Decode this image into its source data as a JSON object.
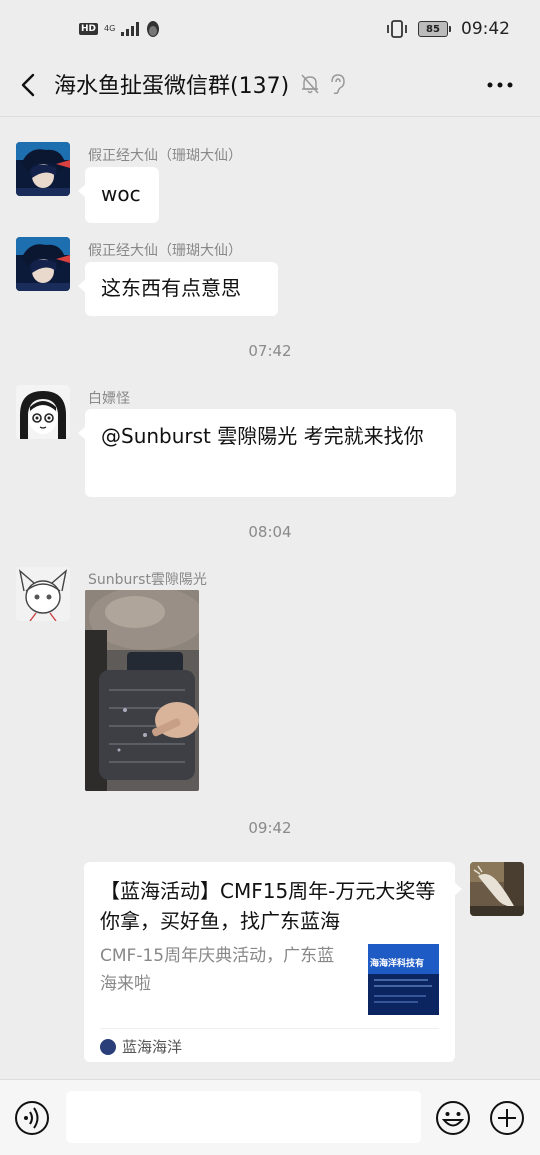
{
  "status_bar": {
    "network_badge": "HD",
    "signal_label": "4G",
    "battery_level": "85",
    "time": "09:42"
  },
  "nav": {
    "title": "海水鱼扯蛋微信群(137)"
  },
  "messages": [
    {
      "sender": "假正经大仙（珊瑚大仙）",
      "text": "woc"
    },
    {
      "sender": "假正经大仙（珊瑚大仙）",
      "text": "这东西有点意思"
    },
    {
      "sender": "白嫖怪",
      "text": "@Sunburst 雲隙陽光  考完就来找你"
    },
    {
      "sender": "Sunburst雲隙陽光"
    }
  ],
  "timestamps": [
    "07:42",
    "08:04",
    "09:42"
  ],
  "link_card": {
    "title": "【蓝海活动】CMF15周年-万元大奖等你拿，买好鱼，找广东蓝海",
    "description": "CMF-15周年庆典活动，广东蓝海来啦",
    "thumb_heading": "海海洋科技有",
    "source": "蓝海海洋"
  },
  "input_bar": {
    "placeholder": ""
  },
  "colors": {
    "background": "#ededed",
    "bubble": "#ffffff",
    "meta_text": "#888888"
  }
}
